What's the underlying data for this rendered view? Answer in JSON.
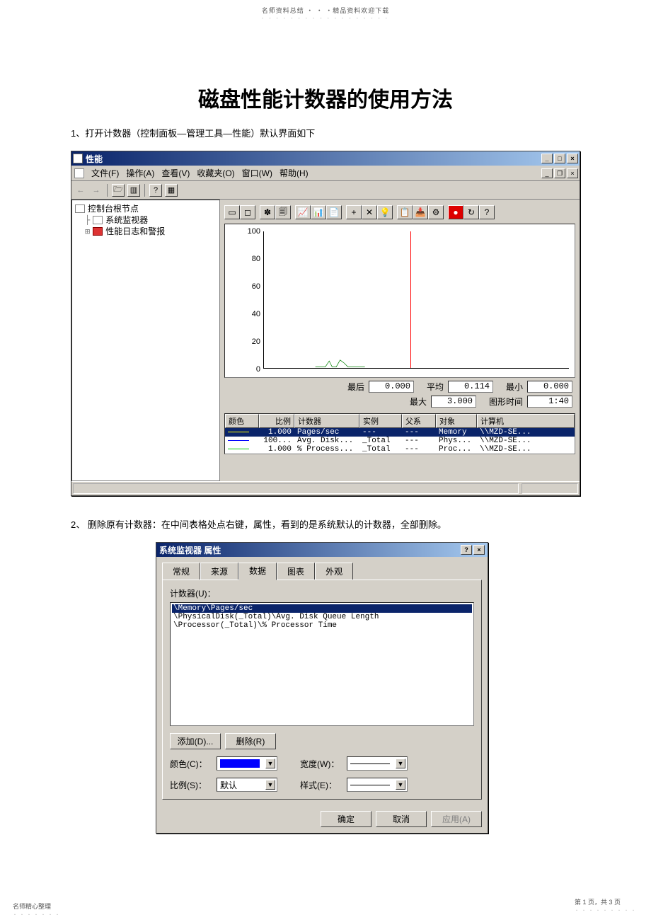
{
  "doc": {
    "header_top": "名师资料总结 ・ ・ ・精品资料欢迎下载",
    "main_title": "磁盘性能计数器的使用方法",
    "step1": "1、打开计数器（控制面板—管理工具—性能）默认界面如下",
    "step2": "2、 删除原有计数器：在中间表格处点右键，属性，看到的是系统默认的计数器，全部删除。",
    "footer_left": "名师精心整理",
    "footer_right": "第 1 页，共 3 页"
  },
  "win1": {
    "title": "性能",
    "min_btn": "_",
    "max_btn": "□",
    "close_btn": "×",
    "menu": {
      "file": "文件(F)",
      "action": "操作(A)",
      "view": "查看(V)",
      "fav": "收藏夹(O)",
      "window": "窗口(W)",
      "help": "帮助(H)"
    },
    "tree": {
      "root": "控制台根节点",
      "sysmon": "系统监视器",
      "perflogs": "性能日志和警报"
    },
    "yticks": {
      "y100": "100",
      "y80": "80",
      "y60": "60",
      "y40": "40",
      "y20": "20",
      "y0": "0"
    },
    "stats": {
      "last_lbl": "最后",
      "last_val": "0.000",
      "avg_lbl": "平均",
      "avg_val": "0.114",
      "min_lbl": "最小",
      "min_val": "0.000",
      "max_lbl": "最大",
      "max_val": "3.000",
      "dur_lbl": "图形时间",
      "dur_val": "1:40"
    },
    "table": {
      "headers": {
        "color": "颜色",
        "scale": "比例",
        "counter": "计数器",
        "inst": "实例",
        "parent": "父系",
        "obj": "对象",
        "comp": "计算机"
      },
      "rows": [
        {
          "color": "#ffff00",
          "scale": "1.000",
          "counter": "Pages/sec",
          "inst": "---",
          "parent": "---",
          "obj": "Memory",
          "comp": "\\\\MZD-SE..."
        },
        {
          "color": "#0000ff",
          "scale": "100...",
          "counter": "Avg. Disk...",
          "inst": "_Total",
          "parent": "---",
          "obj": "Phys...",
          "comp": "\\\\MZD-SE..."
        },
        {
          "color": "#00ff00",
          "scale": "1.000",
          "counter": "% Process...",
          "inst": "_Total",
          "parent": "---",
          "obj": "Proc...",
          "comp": "\\\\MZD-SE..."
        }
      ]
    }
  },
  "win2": {
    "title": "系统监视器 属性",
    "help_btn": "?",
    "close_btn": "×",
    "tabs": {
      "general": "常规",
      "source": "来源",
      "data": "数据",
      "chart": "图表",
      "appearance": "外观"
    },
    "counters_lbl": "计数器(U)：",
    "list": [
      "\\Memory\\Pages/sec",
      "\\PhysicalDisk(_Total)\\Avg. Disk Queue Length",
      "\\Processor(_Total)\\% Processor Time"
    ],
    "btn_add": "添加(D)...",
    "btn_remove": "删除(R)",
    "color_lbl": "颜色(C)：",
    "width_lbl": "宽度(W)：",
    "scale_lbl": "比例(S)：",
    "scale_val": "默认",
    "style_lbl": "样式(E)：",
    "ok": "确定",
    "cancel": "取消",
    "apply": "应用(A)"
  },
  "chart_data": {
    "type": "line",
    "title": "",
    "ylim": [
      0,
      100
    ],
    "yticks": [
      0,
      20,
      40,
      60,
      80,
      100
    ],
    "series": [
      {
        "name": "Pages/sec",
        "color": "#ffff00"
      },
      {
        "name": "Avg. Disk Queue Length",
        "color": "#0000ff"
      },
      {
        "name": "% Processor Time",
        "color": "#00ff00"
      }
    ],
    "stats": {
      "last": 0.0,
      "avg": 0.114,
      "min": 0.0,
      "max": 3.0,
      "duration": "1:40"
    }
  }
}
